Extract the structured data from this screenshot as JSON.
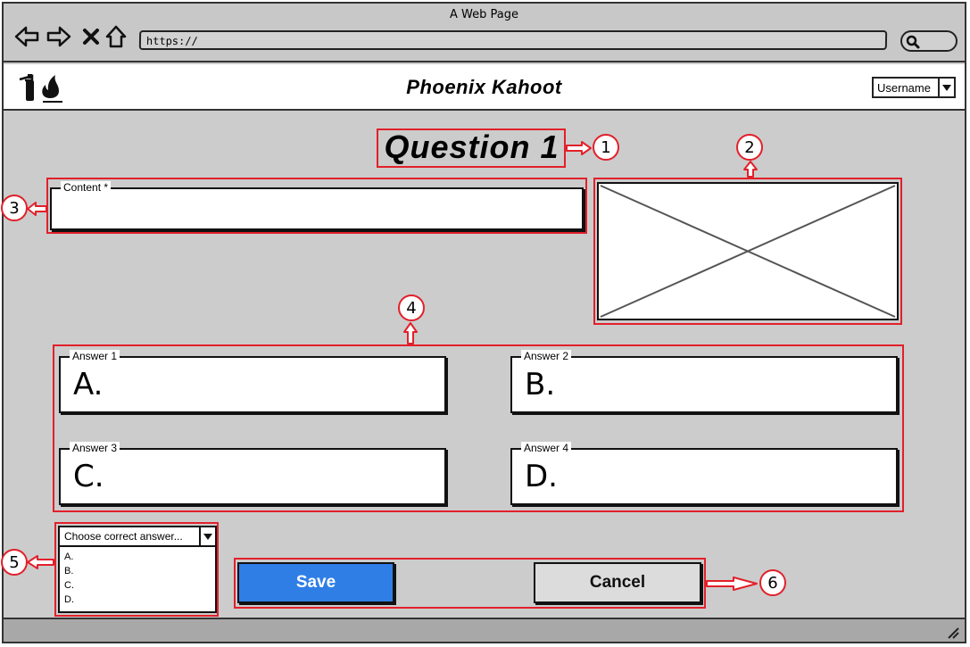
{
  "window": {
    "title": "A Web Page"
  },
  "browser": {
    "url": "https://",
    "nav_icons": [
      "back-arrow-icon",
      "forward-arrow-icon",
      "close-x-icon",
      "home-icon"
    ],
    "search_icon": "search-icon"
  },
  "app": {
    "title": "Phoenix Kahoot",
    "logo_icons": [
      "fire-extinguisher-icon",
      "flame-icon"
    ],
    "user_menu": {
      "selected": "Username"
    }
  },
  "question": {
    "title": "Question 1",
    "content_label": "Content *",
    "content_value": "",
    "image_placeholder_icon": "image-placeholder-icon"
  },
  "answers": [
    {
      "label": "Answer 1",
      "letter": "A."
    },
    {
      "label": "Answer 2",
      "letter": "B."
    },
    {
      "label": "Answer 3",
      "letter": "C."
    },
    {
      "label": "Answer 4",
      "letter": "D."
    }
  ],
  "correct_answer": {
    "placeholder": "Choose correct answer...",
    "options": [
      "A.",
      "B.",
      "C.",
      "D."
    ]
  },
  "actions": {
    "save_label": "Save",
    "cancel_label": "Cancel"
  },
  "annotations": [
    "1",
    "2",
    "3",
    "4",
    "5",
    "6"
  ],
  "colors": {
    "annotation_red": "#e2202a",
    "save_blue": "#2f7ee6",
    "background_gray": "#cccccc"
  }
}
